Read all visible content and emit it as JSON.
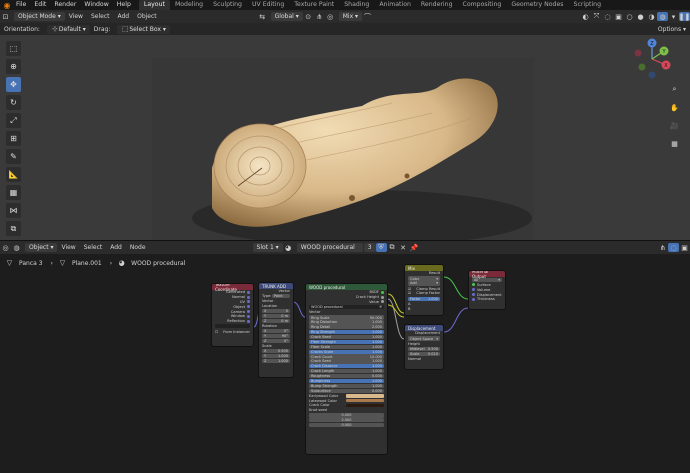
{
  "top_menu": [
    "File",
    "Edit",
    "Render",
    "Window",
    "Help"
  ],
  "workspace_tabs": [
    "Layout",
    "Modeling",
    "Sculpting",
    "UV Editing",
    "Texture Paint",
    "Shading",
    "Animation",
    "Rendering",
    "Compositing",
    "Geometry Nodes",
    "Scripting"
  ],
  "viewport_header": {
    "mode": "Object Mode",
    "menus": [
      "View",
      "Select",
      "Add",
      "Object"
    ],
    "orientation": "Global",
    "mix": "Mix"
  },
  "tool_settings": {
    "orientation_label": "Orientation:",
    "orientation_value": "Default",
    "drag_label": "Drag:",
    "drag_value": "Select Box",
    "options": "Options"
  },
  "gizmo": {
    "x": "X",
    "y": "Y",
    "z": "Z"
  },
  "node_editor_header": {
    "editor": "Object",
    "menus": [
      "View",
      "Select",
      "Add",
      "Node"
    ],
    "slot": "Slot 1",
    "material": "WOOD procedural",
    "users": "3"
  },
  "breadcrumb": [
    "Panca 3",
    "Plane.001",
    "WOOD procedural"
  ],
  "nodes": {
    "texcoord": {
      "title": "Texture Coordinate",
      "outputs": [
        "Generated",
        "Normal",
        "UV",
        "Object",
        "Camera",
        "Window",
        "Reflection"
      ],
      "object_field": "",
      "from_instancer": "From Instancer"
    },
    "mapping": {
      "title": "TRUNK ADD",
      "out": "Vector",
      "type_label": "Type:",
      "type_value": "Point",
      "vector": "Vector",
      "location": "Location",
      "loc": [
        "0",
        "0 m",
        "0 m"
      ],
      "rotation": "Rotation",
      "rot": [
        "0°",
        "90°",
        "0°"
      ],
      "scale": "Scale",
      "scl": [
        "0.500",
        "1.000",
        "1.000"
      ],
      "xyz": [
        "X",
        "Y",
        "Z"
      ]
    },
    "wood": {
      "title": "WOOD procedural",
      "outputs": [
        "BSDF",
        "Crack Height",
        "Value"
      ],
      "group": "WOOD procedural",
      "vector": "Vector",
      "fields": [
        {
          "l": "Ring Scale",
          "v": "90.000"
        },
        {
          "l": "Ring Distortion",
          "v": "1.000"
        },
        {
          "l": "Ring Detail",
          "v": "2.000"
        },
        {
          "l": "Ring Strength",
          "v": "1.000",
          "blue": true
        },
        {
          "l": "Crack Seed",
          "v": "1.000"
        },
        {
          "l": "Fiber Strength",
          "v": "1.000",
          "blue": true
        },
        {
          "l": "Fiber Scale",
          "v": "1.000"
        },
        {
          "l": "Cracks Scale",
          "v": "1.000",
          "blue": true
        },
        {
          "l": "Crack Count",
          "v": "10.000"
        },
        {
          "l": "Crack Seed",
          "v": "1.000"
        },
        {
          "l": "Crack Distance",
          "v": "1.000",
          "blue": true
        },
        {
          "l": "Crack Length",
          "v": "1.000"
        },
        {
          "l": "Roughness",
          "v": "0.000"
        },
        {
          "l": "Bumpiness",
          "v": "1.000",
          "blue": true
        },
        {
          "l": "Bump Strength",
          "v": "1.000"
        },
        {
          "l": "Subsurface",
          "v": "0.000"
        }
      ],
      "colors": [
        {
          "l": "Earlywood Color",
          "c": "#d8b88c"
        },
        {
          "l": "Latewood Color",
          "c": "#a87a4c"
        },
        {
          "l": "Crack Color",
          "c": "#2a1a10"
        }
      ],
      "knot_seed": "Knot seed",
      "knot_vals": [
        "0.000",
        "2.000",
        "0.000"
      ]
    },
    "mix": {
      "title": "Mix",
      "result": "Result",
      "data_type": "Color",
      "blend": "Add",
      "clamp_result": "Clamp Result",
      "clamp_factor": "Clamp Factor",
      "factor": "Factor",
      "factor_v": "1.000",
      "a": "A",
      "b": "B"
    },
    "displacement": {
      "title": "Displacement",
      "out": "Displacement",
      "space": "Object Space",
      "height": "Height",
      "midlevel": "Midlevel",
      "midlevel_v": "0.500",
      "scale": "Scale",
      "scale_v": "0.010",
      "normal": "Normal"
    },
    "output": {
      "title": "Material Output",
      "target": "All",
      "inputs": [
        "Surface",
        "Volume",
        "Displacement",
        "Thickness"
      ]
    }
  }
}
